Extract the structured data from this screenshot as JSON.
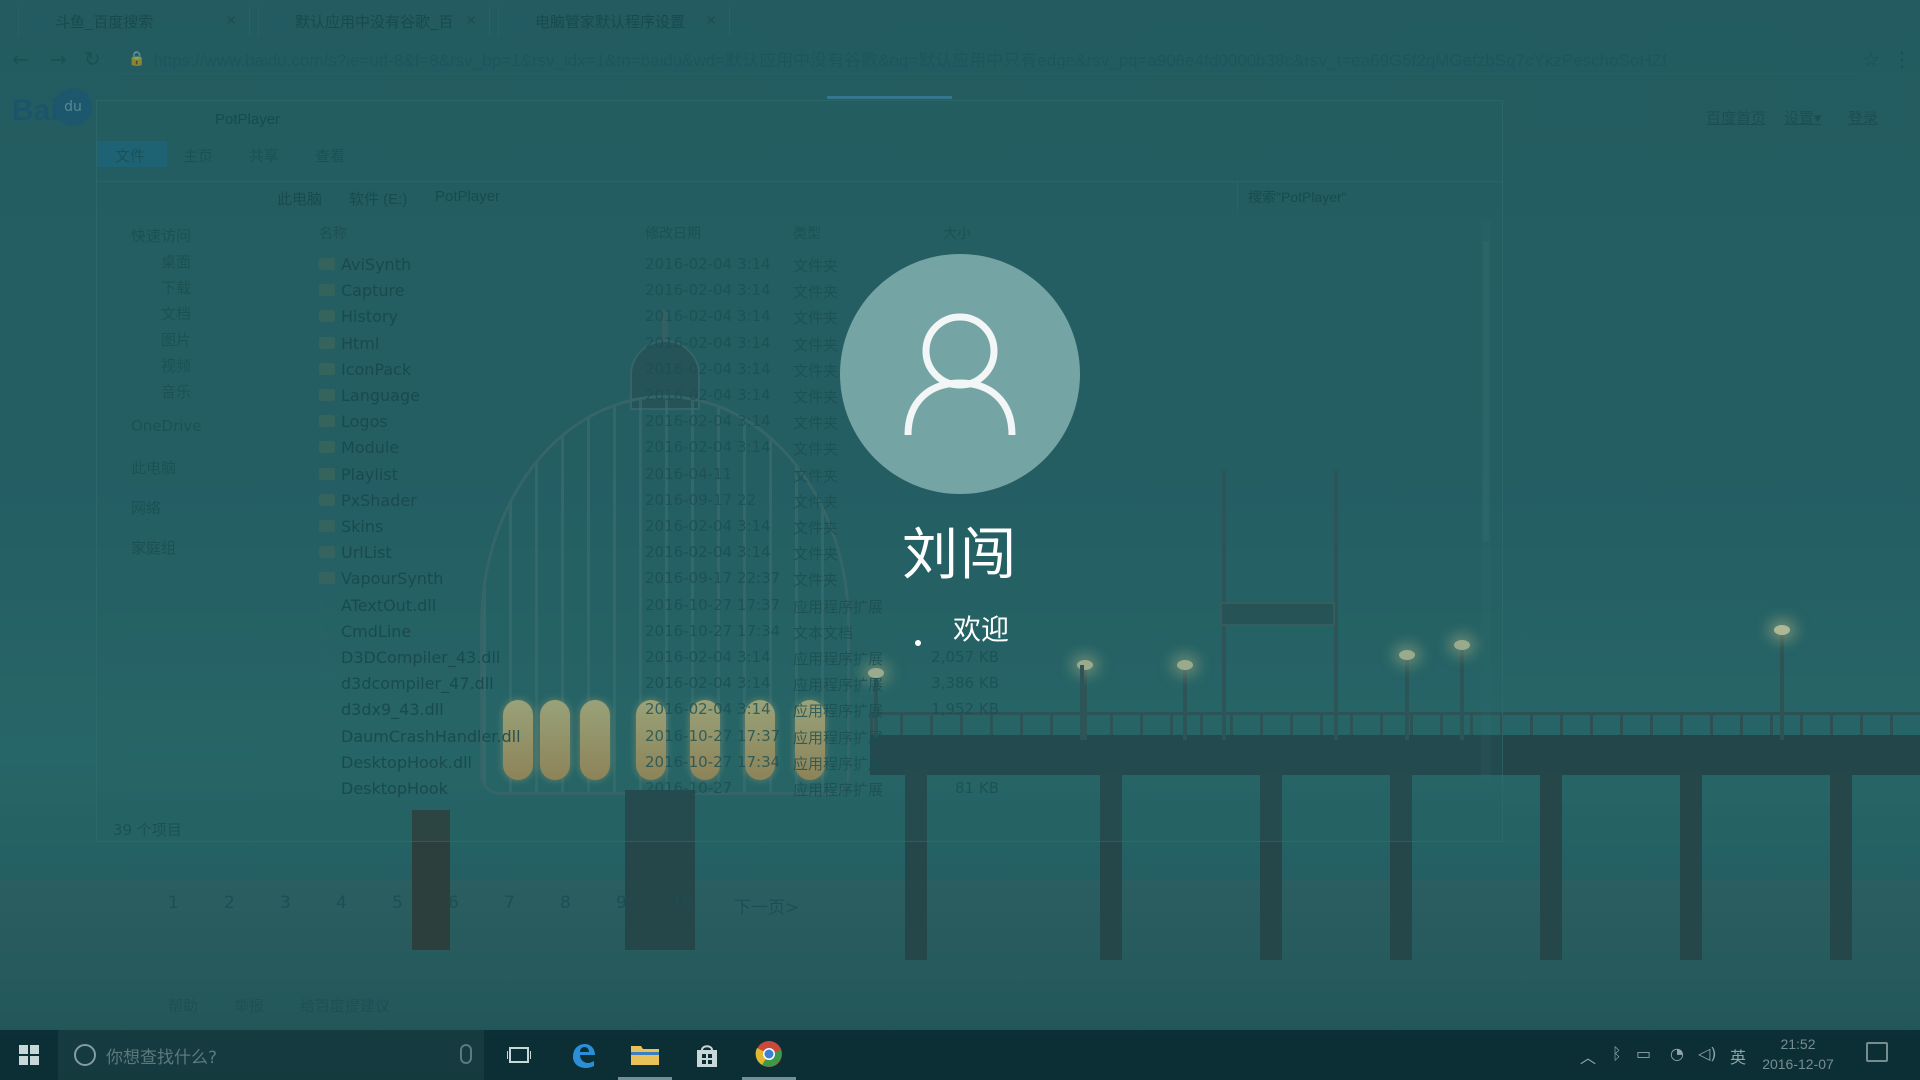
{
  "browser": {
    "tabs": [
      {
        "label": "斗鱼_百度搜索"
      },
      {
        "label": "默认应用中没有谷歌_百"
      },
      {
        "label": "电脑管家默认程序设置"
      }
    ],
    "url": "https://www.baidu.com/s?ie=utf-8&f=8&rsv_bp=1&rsv_idx=1&tn=baidu&wd=默认应用中没有谷歌&oq=默认应用中只有edge&rsv_pq=a906e4fd0000b38c&rsv_t=ea69G5f2qMGefzbSq7cYkzPeschoSoHZf",
    "baidu_logo": "Bai",
    "baidu_logo_du": "du",
    "top_links": [
      "百度首页",
      "设置▾",
      "登录"
    ],
    "pager": [
      "1",
      "2",
      "3",
      "4",
      "5",
      "6",
      "7",
      "8",
      "9",
      "10",
      "下一页>"
    ],
    "footer_links": [
      "帮助",
      "举报",
      "给百度提建议"
    ]
  },
  "explorer": {
    "title": "PotPlayer",
    "ribbon_tabs": [
      "文件",
      "主页",
      "共享",
      "查看"
    ],
    "breadcrumb": [
      "此电脑",
      "软件 (E:)",
      "PotPlayer"
    ],
    "search_placeholder": "搜索\"PotPlayer\"",
    "nav": [
      "快速访问",
      "桌面",
      "下载",
      "文档",
      "图片",
      "视频",
      "音乐",
      "OneDrive",
      "此电脑",
      "网络",
      "家庭组"
    ],
    "columns": [
      "名称",
      "修改日期",
      "类型",
      "大小"
    ],
    "files": [
      {
        "name": "AviSynth",
        "date": "2016-02-04 3:14",
        "type": "文件夹",
        "size": "",
        "folder": true
      },
      {
        "name": "Capture",
        "date": "2016-02-04 3:14",
        "type": "文件夹",
        "size": "",
        "folder": true
      },
      {
        "name": "History",
        "date": "2016-02-04 3:14",
        "type": "文件夹",
        "size": "",
        "folder": true
      },
      {
        "name": "Html",
        "date": "2016-02-04 3:14",
        "type": "文件夹",
        "size": "",
        "folder": true
      },
      {
        "name": "IconPack",
        "date": "2016-02-04 3:14",
        "type": "文件夹",
        "size": "",
        "folder": true
      },
      {
        "name": "Language",
        "date": "2016-02-04 3:14",
        "type": "文件夹",
        "size": "",
        "folder": true
      },
      {
        "name": "Logos",
        "date": "2016-02-04 3:14",
        "type": "文件夹",
        "size": "",
        "folder": true
      },
      {
        "name": "Module",
        "date": "2016-02-04 3:14",
        "type": "文件夹",
        "size": "",
        "folder": true
      },
      {
        "name": "Playlist",
        "date": "2016-04-11",
        "type": "文件夹",
        "size": "",
        "folder": true
      },
      {
        "name": "PxShader",
        "date": "2016-09-17 22",
        "type": "文件夹",
        "size": "",
        "folder": true
      },
      {
        "name": "Skins",
        "date": "2016-02-04 3:14",
        "type": "文件夹",
        "size": "",
        "folder": true
      },
      {
        "name": "UrlList",
        "date": "2016-02-04 3:14",
        "type": "文件夹",
        "size": "",
        "folder": true
      },
      {
        "name": "VapourSynth",
        "date": "2016-09-17 22:37",
        "type": "文件夹",
        "size": "",
        "folder": true
      },
      {
        "name": "ATextOut.dll",
        "date": "2016-10-27 17:37",
        "type": "应用程序扩展",
        "size": "",
        "folder": false
      },
      {
        "name": "CmdLine",
        "date": "2016-10-27 17:34",
        "type": "文本文档",
        "size": "",
        "folder": false
      },
      {
        "name": "D3DCompiler_43.dll",
        "date": "2016-02-04 3:14",
        "type": "应用程序扩展",
        "size": "2,057 KB",
        "folder": false
      },
      {
        "name": "d3dcompiler_47.dll",
        "date": "2016-02-04 3:14",
        "type": "应用程序扩展",
        "size": "3,386 KB",
        "folder": false
      },
      {
        "name": "d3dx9_43.dll",
        "date": "2016-02-04 3:14",
        "type": "应用程序扩展",
        "size": "1,952 KB",
        "folder": false
      },
      {
        "name": "DaumCrashHandler.dll",
        "date": "2016-10-27 17:37",
        "type": "应用程序扩展",
        "size": "",
        "folder": false
      },
      {
        "name": "DesktopHook.dll",
        "date": "2016-10-27 17:34",
        "type": "应用程序扩展",
        "size": "",
        "folder": false
      },
      {
        "name": "DesktopHook",
        "date": "2016-10-27",
        "type": "应用程序扩展",
        "size": "81 KB",
        "folder": false
      }
    ],
    "status": "39 个项目"
  },
  "lock_screen": {
    "user_name": "刘闯",
    "welcome": "欢迎",
    "avatar_icon": "user-silhouette-icon"
  },
  "taskbar": {
    "search_placeholder": "你想查找什么?",
    "apps": [
      "task-view-icon",
      "edge-icon",
      "file-explorer-icon",
      "store-icon",
      "chrome-icon"
    ],
    "ime": "英",
    "time": "21:52",
    "date": "2016-12-07"
  },
  "colors": {
    "overlay": "#165f64",
    "avatar_bg": "#7aa8a8",
    "text_white": "#ffffff",
    "taskbar": "#0a2d32"
  }
}
